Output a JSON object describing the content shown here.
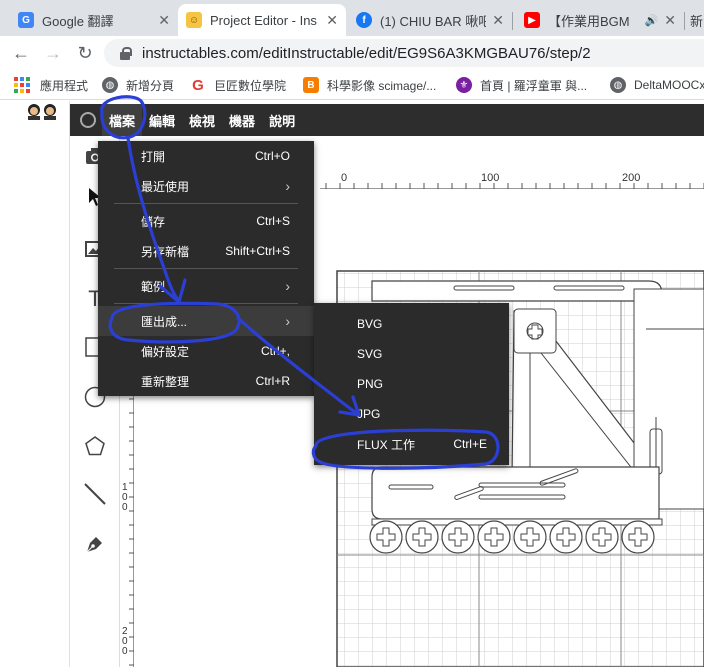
{
  "browser": {
    "tabs": [
      {
        "title": "Google 翻譯",
        "favicon": "google-translate-icon",
        "active": false
      },
      {
        "title": "Project Editor - Ins",
        "favicon": "instructables-robot-icon",
        "active": true
      },
      {
        "title": "(1) CHIU BAR 啾吧",
        "favicon": "facebook-icon",
        "active": false
      },
      {
        "title": "【作業用BGM",
        "favicon": "youtube-icon",
        "active": false
      },
      {
        "title": "新",
        "favicon": "",
        "active": false
      }
    ],
    "url": "instructables.com/editInstructable/edit/EG9S6A3KMGBAU76/step/2",
    "bookmarks": [
      {
        "label": "應用程式",
        "icon": "apps-grid-icon"
      },
      {
        "label": "新增分頁",
        "icon": "globe-icon"
      },
      {
        "label": "巨匠數位學院",
        "icon": "g-logo-icon"
      },
      {
        "label": "科學影像 scimage/...",
        "icon": "blogger-icon"
      },
      {
        "label": "首頁 | 羅浮童軍 與...",
        "icon": "scout-icon"
      },
      {
        "label": "DeltaMOOCx",
        "icon": "globe-icon"
      }
    ]
  },
  "app": {
    "menubar": [
      {
        "label": "檔案",
        "open": true
      },
      {
        "label": "編輯",
        "open": false
      },
      {
        "label": "檢視",
        "open": false
      },
      {
        "label": "機器",
        "open": false
      },
      {
        "label": "說明",
        "open": false
      }
    ],
    "file_menu": [
      {
        "label": "打開",
        "shortcut": "Ctrl+O",
        "submenu": false
      },
      {
        "label": "最近使用",
        "shortcut": "",
        "submenu": true
      },
      {
        "separator": true
      },
      {
        "label": "儲存",
        "shortcut": "Ctrl+S",
        "submenu": false
      },
      {
        "label": "另存新檔",
        "shortcut": "Shift+Ctrl+S",
        "submenu": false
      },
      {
        "separator": true
      },
      {
        "label": "範例",
        "shortcut": "",
        "submenu": true
      },
      {
        "separator": true
      },
      {
        "label": "匯出成...",
        "shortcut": "",
        "submenu": true,
        "highlighted": true
      },
      {
        "label": "偏好設定",
        "shortcut": "Ctrl+,",
        "submenu": false
      },
      {
        "label": "重新整理",
        "shortcut": "Ctrl+R",
        "submenu": false
      }
    ],
    "export_menu": [
      {
        "label": "BVG",
        "shortcut": ""
      },
      {
        "label": "SVG",
        "shortcut": ""
      },
      {
        "label": "PNG",
        "shortcut": ""
      },
      {
        "label": "JPG",
        "shortcut": ""
      },
      {
        "label": "FLUX 工作",
        "shortcut": "Ctrl+E"
      }
    ],
    "ruler_h": [
      "0",
      "100",
      "200"
    ],
    "ruler_v": [
      "100",
      "200"
    ],
    "tools": [
      "camera-icon",
      "cursor-icon",
      "image-icon",
      "text-icon",
      "rectangle-icon",
      "ellipse-icon",
      "polygon-icon",
      "line-icon",
      "pen-icon"
    ]
  },
  "colors": {
    "menu_bg": "#2b2b2b",
    "annotation": "#2b3fd4"
  }
}
